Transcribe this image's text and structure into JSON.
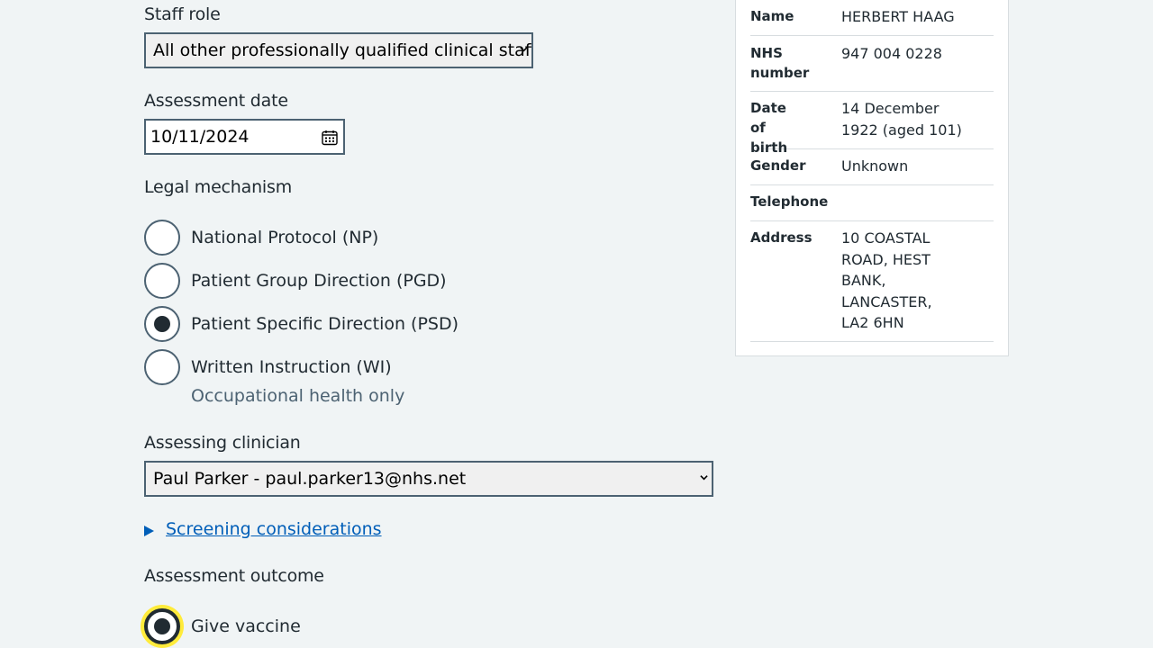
{
  "form": {
    "staff_role": {
      "label": "Staff role",
      "selected": "All other professionally qualified clinical staff"
    },
    "assessment_date": {
      "label": "Assessment date",
      "value": "10/11/2024"
    },
    "legal_mechanism": {
      "label": "Legal mechanism",
      "options": [
        {
          "label": "National Protocol (NP)",
          "checked": false
        },
        {
          "label": "Patient Group Direction (PGD)",
          "checked": false
        },
        {
          "label": "Patient Specific Direction (PSD)",
          "checked": true
        },
        {
          "label": "Written Instruction (WI)",
          "checked": false,
          "hint": "Occupational health only"
        }
      ]
    },
    "assessing_clinician": {
      "label": "Assessing clinician",
      "selected": "Paul Parker - paul.parker13@nhs.net"
    },
    "screening_link": "Screening considerations",
    "assessment_outcome": {
      "label": "Assessment outcome",
      "options": [
        {
          "label": "Give vaccine",
          "checked": true
        }
      ]
    }
  },
  "patient": {
    "rows": [
      {
        "key": "Name",
        "value": "HERBERT HAAG"
      },
      {
        "key": "NHS number",
        "value": "947 004 0228"
      },
      {
        "key": "Date of birth",
        "value": "14 December 1922 (aged 101)"
      },
      {
        "key": "Gender",
        "value": "Unknown"
      },
      {
        "key": "Telephone",
        "value": ""
      },
      {
        "key": "Address",
        "value": "10 COASTAL ROAD, HEST BANK, LANCASTER, LA2 6HN"
      }
    ]
  },
  "colors": {
    "background": "#f0f4f5",
    "text": "#212b32",
    "link": "#005eb8",
    "border": "#4c6272",
    "focus": "#ffeb3b"
  }
}
